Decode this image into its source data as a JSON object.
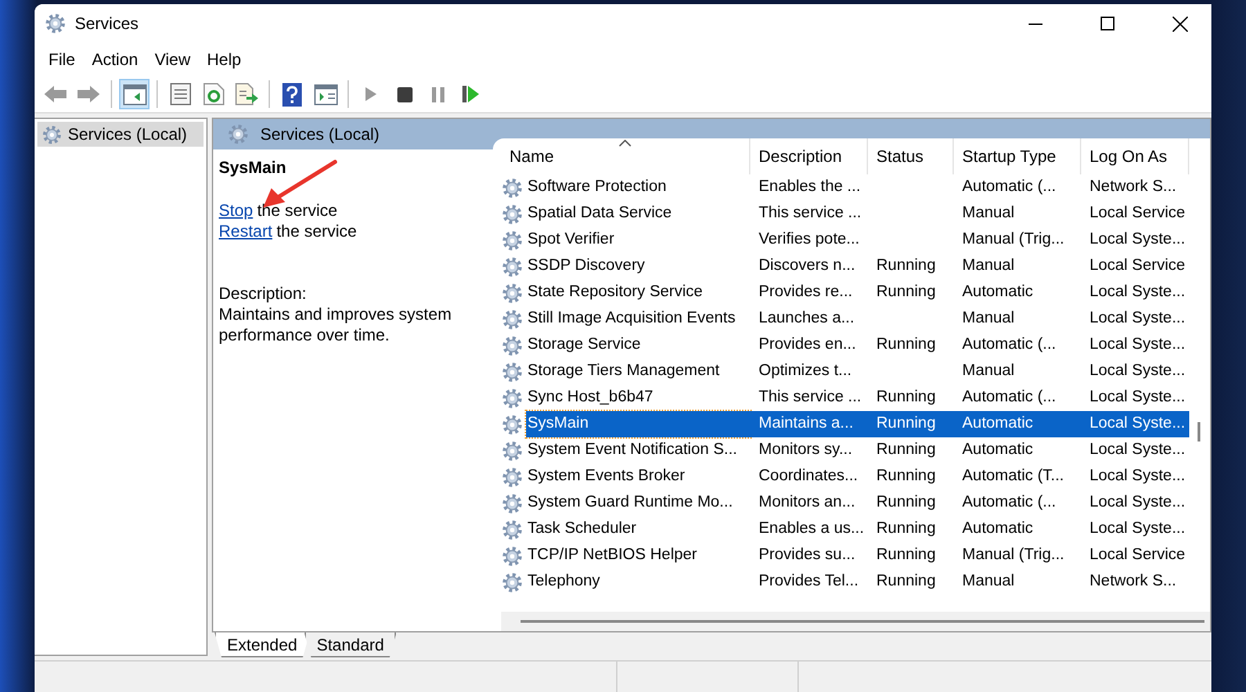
{
  "window": {
    "title": "Services"
  },
  "menu": [
    "File",
    "Action",
    "View",
    "Help"
  ],
  "toolbar": [
    [
      {
        "kind": "back",
        "selected": false
      },
      {
        "kind": "forward",
        "selected": false
      }
    ],
    [
      {
        "kind": "tree",
        "selected": true
      }
    ],
    [
      {
        "kind": "properties",
        "selected": false
      },
      {
        "kind": "refresh",
        "selected": false
      },
      {
        "kind": "export",
        "selected": false
      }
    ],
    [
      {
        "kind": "help",
        "selected": false
      },
      {
        "kind": "pane",
        "selected": false
      }
    ],
    [
      {
        "kind": "play",
        "selected": false
      },
      {
        "kind": "stop",
        "selected": false
      },
      {
        "kind": "pause",
        "selected": false
      },
      {
        "kind": "resume",
        "selected": false
      }
    ]
  ],
  "tree": [
    {
      "label": "Services (Local)",
      "selected": true
    }
  ],
  "panel_header": "Services (Local)",
  "detail": {
    "title": "SysMain",
    "actions": [
      {
        "link": "Stop",
        "text": "the service"
      },
      {
        "link": "Restart",
        "text": "the service"
      }
    ],
    "description_label": "Description:",
    "description": "Maintains and improves system performance over time."
  },
  "table": {
    "columns": [
      {
        "label": "Name",
        "sorted": true
      },
      {
        "label": "Description",
        "sorted": false
      },
      {
        "label": "Status",
        "sorted": false
      },
      {
        "label": "Startup Type",
        "sorted": false
      },
      {
        "label": "Log On As",
        "sorted": false
      }
    ],
    "rows": [
      {
        "cells": [
          "Software Protection",
          "Enables the ...",
          "",
          "Automatic (...",
          "Network S..."
        ],
        "selected": false
      },
      {
        "cells": [
          "Spatial Data Service",
          "This service ...",
          "",
          "Manual",
          "Local Service"
        ],
        "selected": false
      },
      {
        "cells": [
          "Spot Verifier",
          "Verifies pote...",
          "",
          "Manual (Trig...",
          "Local Syste..."
        ],
        "selected": false
      },
      {
        "cells": [
          "SSDP Discovery",
          "Discovers n...",
          "Running",
          "Manual",
          "Local Service"
        ],
        "selected": false
      },
      {
        "cells": [
          "State Repository Service",
          "Provides re...",
          "Running",
          "Automatic",
          "Local Syste..."
        ],
        "selected": false
      },
      {
        "cells": [
          "Still Image Acquisition Events",
          "Launches a...",
          "",
          "Manual",
          "Local Syste..."
        ],
        "selected": false
      },
      {
        "cells": [
          "Storage Service",
          "Provides en...",
          "Running",
          "Automatic (...",
          "Local Syste..."
        ],
        "selected": false
      },
      {
        "cells": [
          "Storage Tiers Management",
          "Optimizes t...",
          "",
          "Manual",
          "Local Syste..."
        ],
        "selected": false
      },
      {
        "cells": [
          "Sync Host_b6b47",
          "This service ...",
          "Running",
          "Automatic (...",
          "Local Syste..."
        ],
        "selected": false
      },
      {
        "cells": [
          "SysMain",
          "Maintains a...",
          "Running",
          "Automatic",
          "Local Syste..."
        ],
        "selected": true
      },
      {
        "cells": [
          "System Event Notification S...",
          "Monitors sy...",
          "Running",
          "Automatic",
          "Local Syste..."
        ],
        "selected": false
      },
      {
        "cells": [
          "System Events Broker",
          "Coordinates...",
          "Running",
          "Automatic (T...",
          "Local Syste..."
        ],
        "selected": false
      },
      {
        "cells": [
          "System Guard Runtime Mo...",
          "Monitors an...",
          "Running",
          "Automatic (...",
          "Local Syste..."
        ],
        "selected": false
      },
      {
        "cells": [
          "Task Scheduler",
          "Enables a us...",
          "Running",
          "Automatic",
          "Local Syste..."
        ],
        "selected": false
      },
      {
        "cells": [
          "TCP/IP NetBIOS Helper",
          "Provides su...",
          "Running",
          "Manual (Trig...",
          "Local Service"
        ],
        "selected": false
      },
      {
        "cells": [
          "Telephony",
          "Provides Tel...",
          "Running",
          "Manual",
          "Network S..."
        ],
        "selected": false
      }
    ]
  },
  "view_tabs": [
    {
      "label": "Extended",
      "selected": true
    },
    {
      "label": "Standard",
      "selected": false
    }
  ]
}
